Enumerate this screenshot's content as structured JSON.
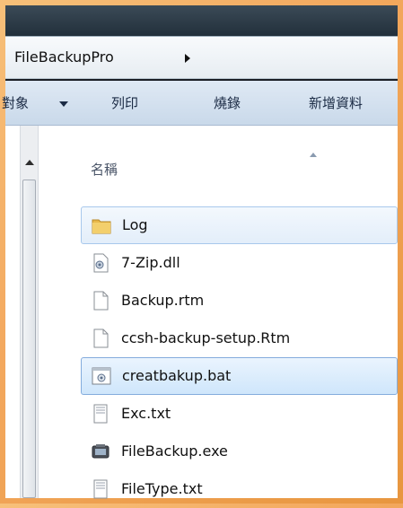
{
  "address": {
    "path": "FileBackupPro"
  },
  "toolbar": {
    "items": [
      {
        "label": "對象"
      },
      {
        "label": "列印"
      },
      {
        "label": "燒錄"
      },
      {
        "label": "新增資料"
      }
    ]
  },
  "list": {
    "column_name": "名稱",
    "files": [
      {
        "name": "Log",
        "icon": "folder-icon"
      },
      {
        "name": "7-Zip.dll",
        "icon": "dll-icon"
      },
      {
        "name": "Backup.rtm",
        "icon": "file-icon"
      },
      {
        "name": "ccsh-backup-setup.Rtm",
        "icon": "file-icon"
      },
      {
        "name": "creatbakup.bat",
        "icon": "batch-icon"
      },
      {
        "name": "Exc.txt",
        "icon": "text-file-icon"
      },
      {
        "name": "FileBackup.exe",
        "icon": "exe-icon"
      },
      {
        "name": "FileType.txt",
        "icon": "text-file-icon"
      }
    ]
  },
  "colors": {
    "selection_border": "#84acdd",
    "folder": "#e8b84a"
  }
}
